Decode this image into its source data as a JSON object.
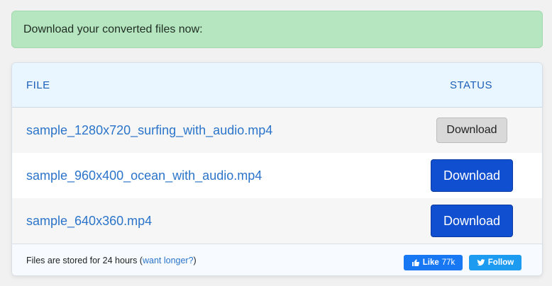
{
  "alert": {
    "text": "Download your converted files now:"
  },
  "table": {
    "headers": {
      "file": "FILE",
      "status": "STATUS"
    },
    "rows": [
      {
        "filename": "sample_1280x720_surfing_with_audio.mp4",
        "button": "Download",
        "state": "default"
      },
      {
        "filename": "sample_960x400_ocean_with_audio.mp4",
        "button": "Download",
        "state": "primary"
      },
      {
        "filename": "sample_640x360.mp4",
        "button": "Download",
        "state": "primary"
      }
    ]
  },
  "footer": {
    "note_prefix": "Files are stored for 24 hours (",
    "note_link": "want longer?",
    "note_suffix": ")",
    "like_label": "Like",
    "like_count": "77k",
    "follow_label": "Follow"
  },
  "colors": {
    "alert_bg": "#b6e6c0",
    "primary_button": "#0f4fd0",
    "link": "#2b74c9",
    "facebook": "#1877f2",
    "twitter": "#1d9bf0"
  },
  "icons": {
    "like": "thumbs-up-icon",
    "follow": "twitter-bird-icon"
  }
}
